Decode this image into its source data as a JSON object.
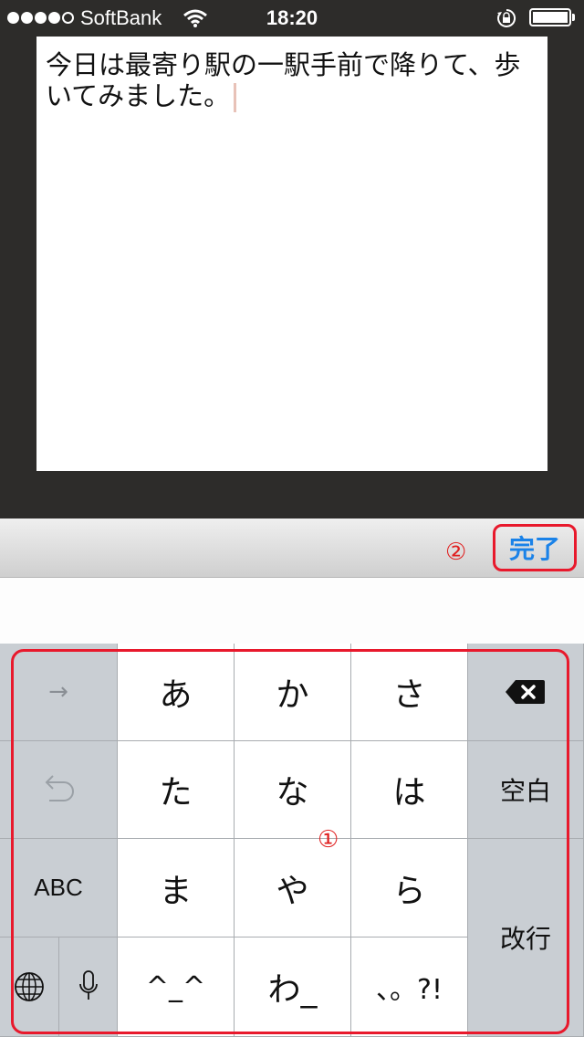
{
  "status_bar": {
    "carrier": "SoftBank",
    "time": "18:20",
    "signal_bars_filled": 4,
    "signal_bars_total": 5,
    "battery_level": 1.0,
    "icons": [
      "wifi-icon",
      "orientation-lock-icon",
      "battery-icon"
    ]
  },
  "note": {
    "text": "今日は最寄り駅の一駅手前で降りて、歩いてみました。"
  },
  "toolbar": {
    "done_label": "完了",
    "marker": "②"
  },
  "keyboard": {
    "marker": "①",
    "keys": {
      "arrow": "→",
      "undo_icon": "undo-icon",
      "abc": "ABC",
      "globe_icon": "globe-icon",
      "mic_icon": "microphone-icon",
      "a": "あ",
      "ka": "か",
      "sa": "さ",
      "ta": "た",
      "na": "な",
      "ha": "は",
      "ma": "ま",
      "ya": "や",
      "ra": "ら",
      "kaomoji": "^_^",
      "wa": "わ_",
      "punct": "、。?!",
      "delete_icon": "backspace-icon",
      "space": "空白",
      "return": "改行"
    }
  },
  "colors": {
    "accent_blue": "#1a82e8",
    "annotation_red": "#e8192c",
    "key_gray": "#c9ced3",
    "background_dark": "#2d2c2a"
  }
}
